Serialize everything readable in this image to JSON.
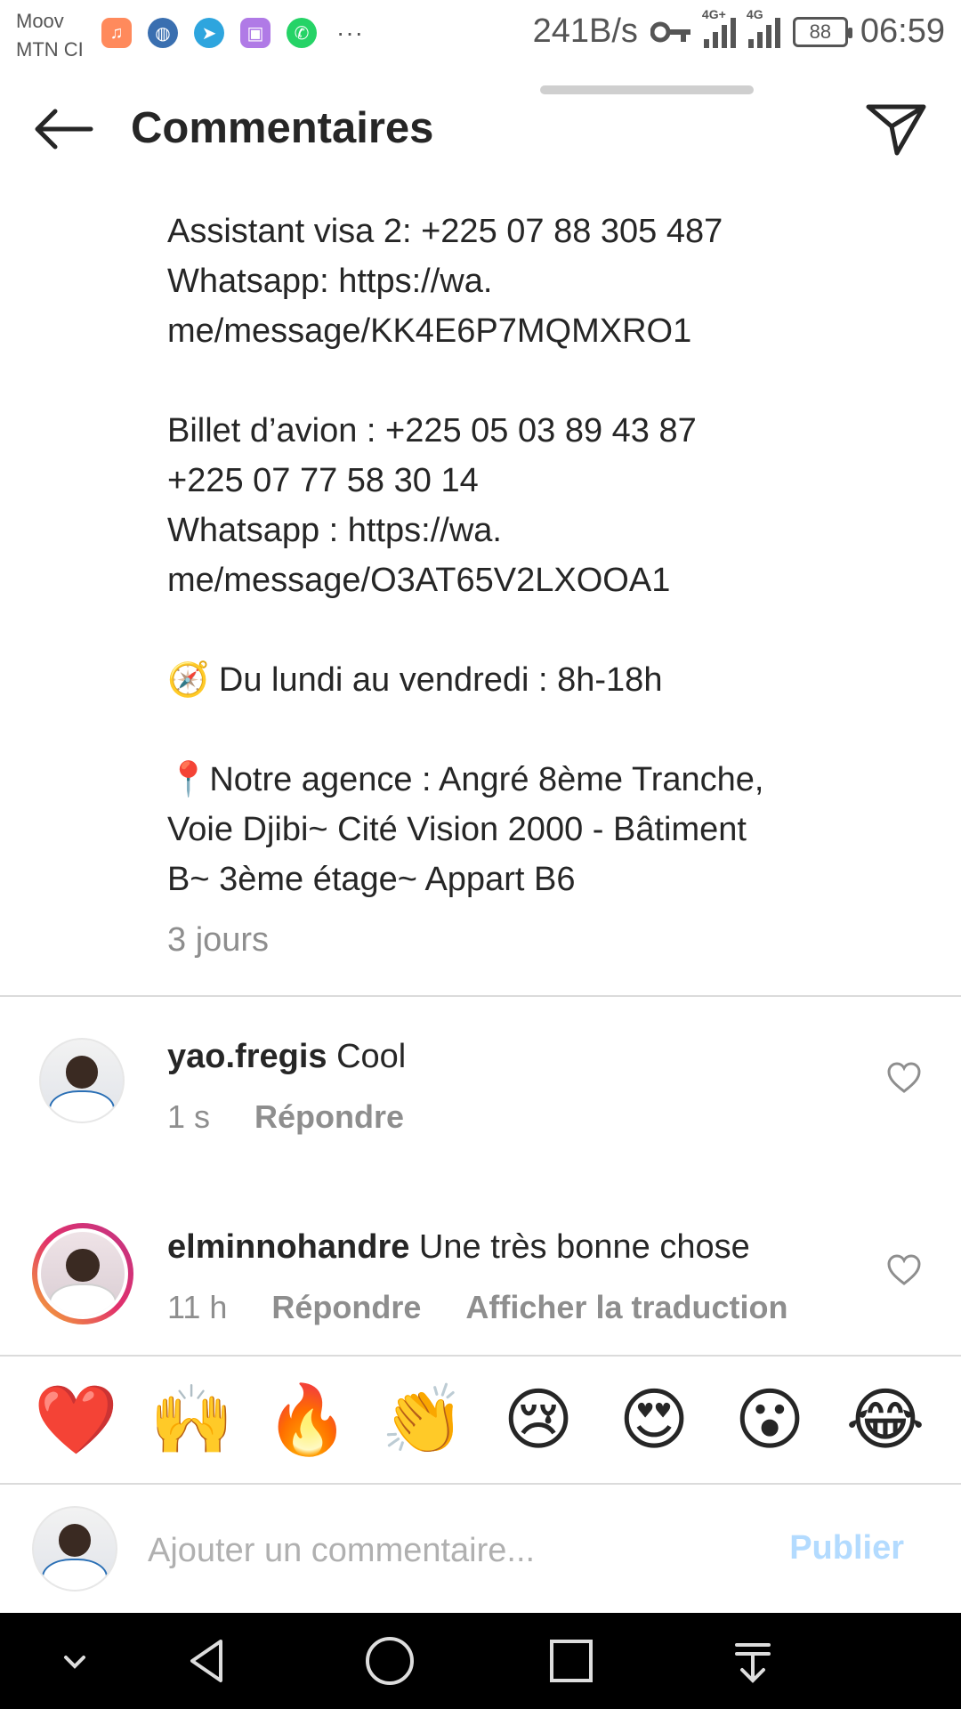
{
  "status_bar": {
    "carrier_1": "Moov",
    "carrier_2": "MTN CI",
    "apps": [
      "music-icon",
      "browser-icon",
      "telegram-icon",
      "gallery-icon",
      "whatsapp-icon"
    ],
    "more": "···",
    "net_speed": "241B/s",
    "sim1_tag": "4G+",
    "sim2_tag": "4G",
    "battery": "88",
    "time": "06:59"
  },
  "header": {
    "title": "Commentaires"
  },
  "caption": {
    "lines_block_1": [
      "Assistant visa 2: +225 07 88 305 487",
      "Whatsapp: https://wa.",
      "me/message/KK4E6P7MQMXRO1"
    ],
    "lines_block_2": [
      "Billet d’avion : +225 05 03 89 43 87",
      "+225 07 77 58 30 14",
      "Whatsapp : https://wa.",
      "me/message/O3AT65V2LXOOA1"
    ],
    "hours_emoji": "🧭",
    "hours": " Du lundi au vendredi : 8h-18h",
    "address_emoji": "📍",
    "address_lines": [
      "Notre agence : Angré 8ème Tranche,",
      "Voie Djibi~ Cité Vision 2000 - Bâtiment",
      "B~ 3ème étage~ Appart B6"
    ],
    "time": "3 jours"
  },
  "comments": [
    {
      "username": "yao.fregis",
      "text": " Cool",
      "time": "1 s",
      "reply": "Répondre"
    },
    {
      "username": "elminnohandre",
      "text": " Une très bonne chose",
      "time": "11 h",
      "reply": "Répondre",
      "translate": "Afficher la traduction"
    }
  ],
  "emoji_bar": [
    "❤️",
    "🙌",
    "🔥",
    "👏",
    "😢",
    "😍",
    "😮",
    "😂"
  ],
  "composer": {
    "placeholder": "Ajouter un commentaire...",
    "publish": "Publier"
  },
  "colors": {
    "text": "#262626",
    "secondary": "#8e8e8e",
    "publish_disabled": "#b3dbff",
    "divider": "#dbdbdb"
  }
}
